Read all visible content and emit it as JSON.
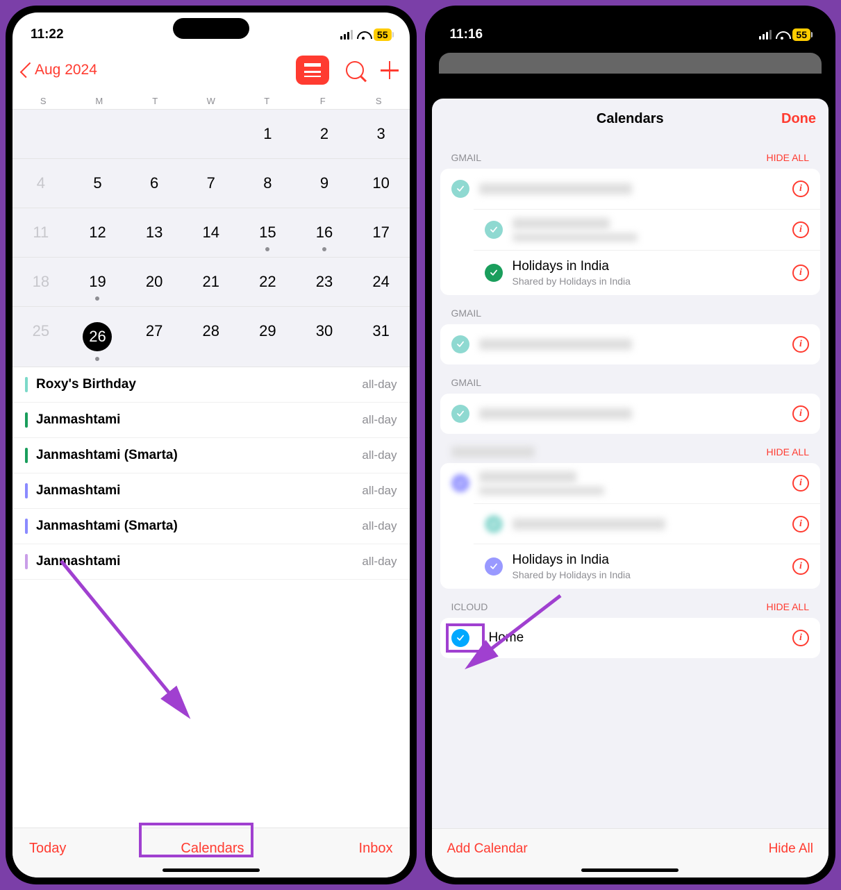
{
  "left": {
    "time": "11:22",
    "battery": "55",
    "month": "Aug 2024",
    "weekdays": [
      "S",
      "M",
      "T",
      "W",
      "T",
      "F",
      "S"
    ],
    "grid": [
      [
        "",
        "",
        "",
        "",
        "1",
        "2",
        "3"
      ],
      [
        "4",
        "5",
        "6",
        "7",
        "8",
        "9",
        "10"
      ],
      [
        "11",
        "12",
        "13",
        "14",
        "15",
        "16",
        "17"
      ],
      [
        "18",
        "19",
        "20",
        "21",
        "22",
        "23",
        "24"
      ],
      [
        "25",
        "26",
        "27",
        "28",
        "29",
        "30",
        "31"
      ]
    ],
    "events": [
      {
        "title": "Roxy's Birthday",
        "time": "all-day",
        "color": "#7cd9c9"
      },
      {
        "title": "Janmashtami",
        "time": "all-day",
        "color": "#1a9e5c"
      },
      {
        "title": "Janmashtami (Smarta)",
        "time": "all-day",
        "color": "#1a9e5c"
      },
      {
        "title": "Janmashtami",
        "time": "all-day",
        "color": "#8a8aff"
      },
      {
        "title": "Janmashtami (Smarta)",
        "time": "all-day",
        "color": "#8a8aff"
      },
      {
        "title": "Janmashtami",
        "time": "all-day",
        "color": "#c99ee8"
      }
    ],
    "bottom": {
      "today": "Today",
      "calendars": "Calendars",
      "inbox": "Inbox"
    }
  },
  "right": {
    "time": "11:16",
    "battery": "55",
    "title": "Calendars",
    "done": "Done",
    "sections": [
      {
        "header": "GMAIL",
        "hide": "HIDE ALL",
        "rows": [
          {
            "check": "#8fd9d1",
            "title": "",
            "sub": "",
            "blur": true
          },
          {
            "check": "#8fd9d1",
            "title": "",
            "sub": "",
            "blur": true,
            "blurSub": true
          },
          {
            "check": "#1a9e5c",
            "title": "Holidays in India",
            "sub": "Shared by Holidays in India"
          }
        ]
      },
      {
        "header": "GMAIL",
        "rows": [
          {
            "check": "#8fd9d1",
            "title": "",
            "blur": true
          }
        ]
      },
      {
        "header": "GMAIL",
        "rows": [
          {
            "check": "#8fd9d1",
            "title": "",
            "blur": true
          }
        ]
      },
      {
        "header": "",
        "hide": "HIDE ALL",
        "blurHeader": true,
        "rows": [
          {
            "check": "#9999ff",
            "title": "",
            "sub": "",
            "blur": true,
            "blurSub": true,
            "blurCheck": true
          },
          {
            "check": "#8fd9d1",
            "title": "",
            "blur": true,
            "blurCheck": true
          },
          {
            "check": "#9999ff",
            "title": "Holidays in India",
            "sub": "Shared by Holidays in India"
          }
        ]
      },
      {
        "header": "ICLOUD",
        "hide": "HIDE ALL",
        "rows": [
          {
            "check": "#00a8ff",
            "title": "Home",
            "highlight": true
          }
        ]
      }
    ],
    "bottom": {
      "add": "Add Calendar",
      "hide": "Hide All"
    }
  }
}
